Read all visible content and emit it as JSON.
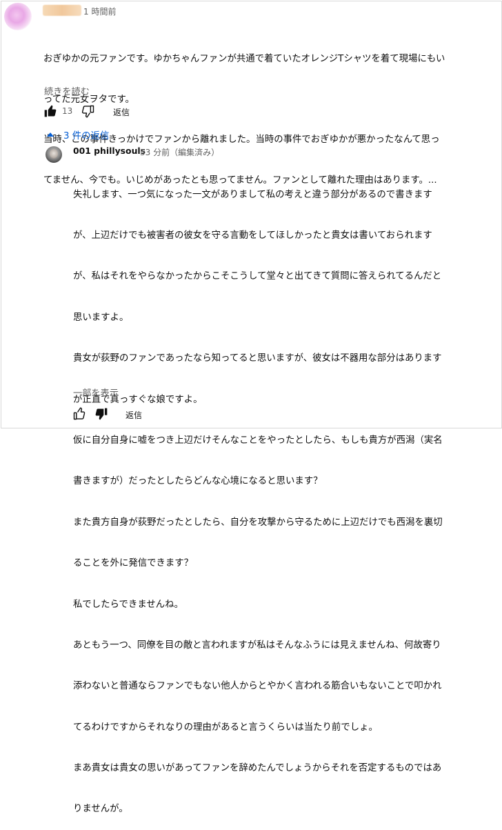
{
  "comment": {
    "timestamp": "1 時間前",
    "text_lines": [
      "おぎゆかの元ファンです。ゆかちゃんファンが共通で着ていたオレンジTシャツを着て現場にもい",
      "ってた元女ヲタです。",
      "当時、この事件きっかけでファンから離れました。当時の事件でおぎゆかが悪かったなんて思っ",
      "てません、今でも。いじめがあったとも思ってません。ファンとして離れた理由はあります。..."
    ],
    "read_more": "続きを読む",
    "like_count": "13",
    "reply_label": "返信"
  },
  "replies_toggle": {
    "label": "3 件の返信"
  },
  "reply": {
    "author": "001 phillysouls",
    "meta": "53 分前（編集済み）",
    "text_lines": [
      "失礼します、一つ気になった一文がありまして私の考えと違う部分があるので書きます",
      "が、上辺だけでも被害者の彼女を守る言動をしてほしかったと貴女は書いておられます",
      "が、私はそれをやらなかったからこそこうして堂々と出てきて質問に答えられてるんだと",
      "思いますよ。",
      "貴女が荻野のファンであったなら知ってると思いますが、彼女は不器用な部分はあります",
      "が正直で真っすぐな娘ですよ。",
      "仮に自分自身に嘘をつき上辺だけそんなことをやったとしたら、もしも貴方が西潟（実名",
      "書きますが）だったとしたらどんな心境になると思います？",
      "また貴方自身が荻野だったとしたら、自分を攻撃から守るために上辺だけでも西潟を裏切",
      "ることを外に発信できます？",
      "私でしたらできませんね。",
      "あともう一つ、同僚を目の敵と言われますが私はそんなふうには見えませんね、何故寄り",
      "添わないと普通ならファンでもない他人からとやかく言われる筋合いもないことで叩かれ",
      "てるわけですからそれなりの理由があると言うくらいは当たり前でしょ。",
      "まあ貴女は貴女の思いがあってファンを辞めたんでしょうからそれを否定するものではあ",
      "りませんが。"
    ],
    "show_part": "一部を表示",
    "reply_label": "返信"
  }
}
